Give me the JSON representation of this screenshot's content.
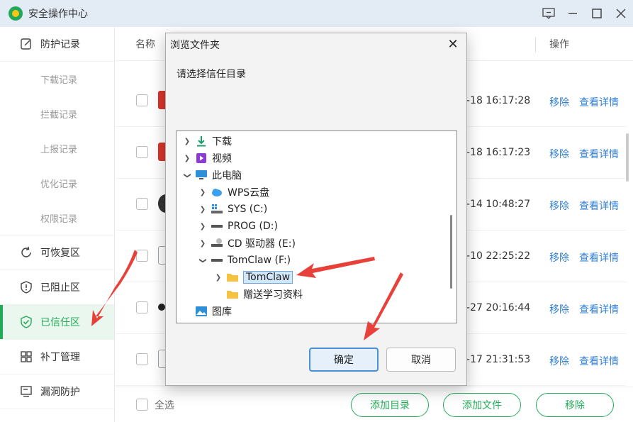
{
  "app": {
    "title": "安全操作中心"
  },
  "sidebar": {
    "items": [
      {
        "label": "防护记录",
        "icon": "edit-icon",
        "sub": false,
        "active": false
      },
      {
        "label": "下载记录",
        "sub": true
      },
      {
        "label": "拦截记录",
        "sub": true
      },
      {
        "label": "上报记录",
        "sub": true
      },
      {
        "label": "优化记录",
        "sub": true
      },
      {
        "label": "权限记录",
        "sub": true
      },
      {
        "label": "可恢复区",
        "icon": "restore-icon",
        "sub": false,
        "active": false
      },
      {
        "label": "已阻止区",
        "icon": "shield-block-icon",
        "sub": false,
        "active": false
      },
      {
        "label": "已信任区",
        "icon": "shield-check-icon",
        "sub": false,
        "active": true
      },
      {
        "label": "补丁管理",
        "icon": "grid-icon",
        "sub": false,
        "active": false
      },
      {
        "label": "漏洞防护",
        "icon": "monitor-icon",
        "sub": false,
        "active": false
      }
    ]
  },
  "table": {
    "col_name": "名称",
    "col_op": "操作",
    "rows": [
      {
        "time": "-18 16:17:28",
        "remove": "移除",
        "detail": "查看详情",
        "thumb_color": "#d9342b"
      },
      {
        "time": "-18 16:17:23",
        "remove": "移除",
        "detail": "查看详情",
        "thumb_color": "#d9342b"
      },
      {
        "time": "-14 10:48:27",
        "remove": "移除",
        "detail": "查看详情",
        "thumb_color": "#333333"
      },
      {
        "time": "-10 22:25:22",
        "remove": "移除",
        "detail": "查看详情",
        "thumb_color": "#9aa4ad"
      },
      {
        "time": "-27 20:16:44",
        "remove": "移除",
        "detail": "查看详情",
        "thumb_color": "#222222"
      },
      {
        "time": "-17 21:31:53",
        "remove": "移除",
        "detail": "查看详情",
        "thumb_color": "#9aa4ad"
      }
    ]
  },
  "bottom": {
    "select_all": "全选",
    "add_dir": "添加目录",
    "add_file": "添加文件",
    "remove": "移除"
  },
  "dialog": {
    "title": "浏览文件夹",
    "prompt": "请选择信任目录",
    "ok": "确定",
    "cancel": "取消",
    "tree": [
      {
        "label": "下载",
        "icon": "download-icon",
        "expand": "collapsed"
      },
      {
        "label": "视频",
        "icon": "video-icon",
        "expand": "collapsed"
      },
      {
        "label": "此电脑",
        "icon": "computer-icon",
        "expand": "expanded"
      },
      {
        "label": "WPS云盘",
        "icon": "cloud-icon",
        "expand": "collapsed"
      },
      {
        "label": "SYS (C:)",
        "icon": "system-drive-icon",
        "expand": "collapsed"
      },
      {
        "label": "PROG (D:)",
        "icon": "drive-icon",
        "expand": "collapsed"
      },
      {
        "label": "CD 驱动器 (E:)",
        "icon": "cd-drive-icon",
        "expand": "collapsed"
      },
      {
        "label": "TomClaw (F:)",
        "icon": "drive-icon",
        "expand": "expanded"
      },
      {
        "label": "TomClaw",
        "icon": "folder-icon",
        "expand": "collapsed",
        "selected": true
      },
      {
        "label": "赠送学习资料",
        "icon": "folder-icon",
        "expand": "none"
      },
      {
        "label": "图库",
        "icon": "gallery-icon",
        "expand": "none"
      }
    ]
  },
  "colors": {
    "accent": "#22ac58",
    "link": "#2f7fd6",
    "annotation": "#e8413a"
  }
}
